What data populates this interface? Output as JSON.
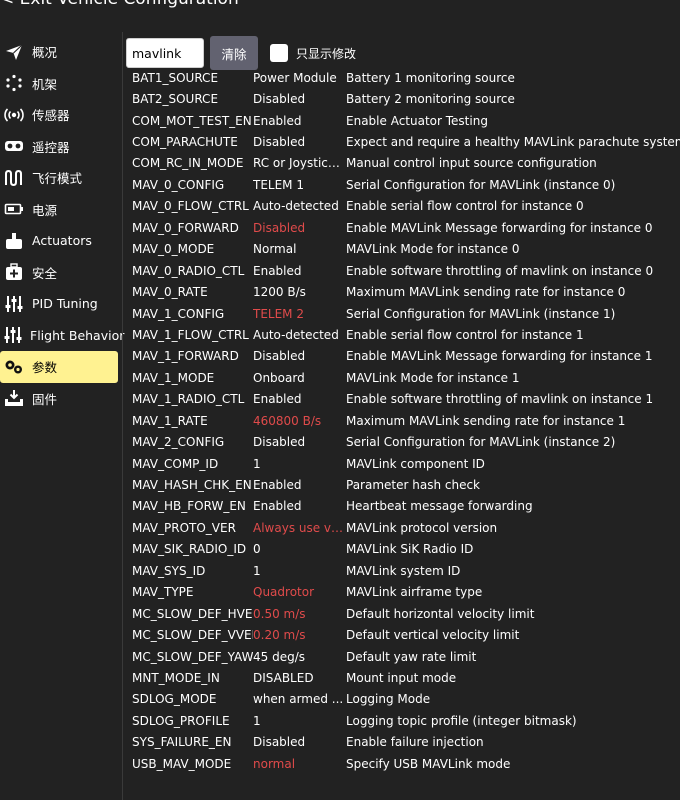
{
  "header": {
    "title": "< Exit Vehicle Configuration"
  },
  "sidebar": {
    "items": [
      {
        "label": "概况",
        "icon": "paper-plane-icon"
      },
      {
        "label": "机架",
        "icon": "airframe-dots-icon"
      },
      {
        "label": "传感器",
        "icon": "sensor-waves-icon"
      },
      {
        "label": "遥控器",
        "icon": "radio-controller-icon"
      },
      {
        "label": "飞行模式",
        "icon": "flight-modes-wave-icon"
      },
      {
        "label": "电源",
        "icon": "battery-icon"
      },
      {
        "label": "Actuators",
        "icon": "actuators-icon"
      },
      {
        "label": "安全",
        "icon": "medical-kit-icon"
      },
      {
        "label": "PID Tuning",
        "icon": "sliders-icon"
      },
      {
        "label": "Flight Behavior",
        "icon": "sliders-icon"
      },
      {
        "label": "参数",
        "icon": "gears-icon",
        "active": true
      },
      {
        "label": "固件",
        "icon": "download-tray-icon"
      }
    ]
  },
  "search": {
    "value": "mavlink",
    "clear_label": "清除",
    "show_modified_label": "只显示修改"
  },
  "colors": {
    "accent": "#fff291",
    "modified": "#e04b4b",
    "background": "#222222",
    "button": "#626270"
  },
  "params": [
    {
      "name": "BAT1_SOURCE",
      "value": "Power Module",
      "desc": "Battery 1 monitoring source",
      "modified": false
    },
    {
      "name": "BAT2_SOURCE",
      "value": "Disabled",
      "desc": "Battery 2 monitoring source",
      "modified": false
    },
    {
      "name": "COM_MOT_TEST_EN",
      "value": "Enabled",
      "desc": "Enable Actuator Testing",
      "modified": false
    },
    {
      "name": "COM_PARACHUTE",
      "value": "Disabled",
      "desc": "Expect and require a healthy MAVLink parachute system",
      "modified": false
    },
    {
      "name": "COM_RC_IN_MODE",
      "value": "RC or Joystick ...",
      "desc": "Manual control input source configuration",
      "modified": false
    },
    {
      "name": "MAV_0_CONFIG",
      "value": "TELEM 1",
      "desc": "Serial Configuration for MAVLink (instance 0)",
      "modified": false
    },
    {
      "name": "MAV_0_FLOW_CTRL",
      "value": "Auto-detected",
      "desc": "Enable serial flow control for instance 0",
      "modified": false
    },
    {
      "name": "MAV_0_FORWARD",
      "value": "Disabled",
      "desc": "Enable MAVLink Message forwarding for instance 0",
      "modified": true
    },
    {
      "name": "MAV_0_MODE",
      "value": "Normal",
      "desc": "MAVLink Mode for instance 0",
      "modified": false
    },
    {
      "name": "MAV_0_RADIO_CTL",
      "value": "Enabled",
      "desc": "Enable software throttling of mavlink on instance 0",
      "modified": false
    },
    {
      "name": "MAV_0_RATE",
      "value": "1200 B/s",
      "desc": "Maximum MAVLink sending rate for instance 0",
      "modified": false
    },
    {
      "name": "MAV_1_CONFIG",
      "value": "TELEM 2",
      "desc": "Serial Configuration for MAVLink (instance 1)",
      "modified": true
    },
    {
      "name": "MAV_1_FLOW_CTRL",
      "value": "Auto-detected",
      "desc": "Enable serial flow control for instance 1",
      "modified": false
    },
    {
      "name": "MAV_1_FORWARD",
      "value": "Disabled",
      "desc": "Enable MAVLink Message forwarding for instance 1",
      "modified": false
    },
    {
      "name": "MAV_1_MODE",
      "value": "Onboard",
      "desc": "MAVLink Mode for instance 1",
      "modified": false
    },
    {
      "name": "MAV_1_RADIO_CTL",
      "value": "Enabled",
      "desc": "Enable software throttling of mavlink on instance 1",
      "modified": false
    },
    {
      "name": "MAV_1_RATE",
      "value": "460800 B/s",
      "desc": "Maximum MAVLink sending rate for instance 1",
      "modified": true
    },
    {
      "name": "MAV_2_CONFIG",
      "value": "Disabled",
      "desc": "Serial Configuration for MAVLink (instance 2)",
      "modified": false
    },
    {
      "name": "MAV_COMP_ID",
      "value": "1",
      "desc": "MAVLink component ID",
      "modified": false
    },
    {
      "name": "MAV_HASH_CHK_EN",
      "value": "Enabled",
      "desc": "Parameter hash check",
      "modified": false
    },
    {
      "name": "MAV_HB_FORW_EN",
      "value": "Enabled",
      "desc": "Heartbeat message forwarding",
      "modified": false
    },
    {
      "name": "MAV_PROTO_VER",
      "value": "Always use ve...",
      "desc": "MAVLink protocol version",
      "modified": true
    },
    {
      "name": "MAV_SIK_RADIO_ID",
      "value": "0",
      "desc": "MAVLink SiK Radio ID",
      "modified": false
    },
    {
      "name": "MAV_SYS_ID",
      "value": "1",
      "desc": "MAVLink system ID",
      "modified": false
    },
    {
      "name": "MAV_TYPE",
      "value": "Quadrotor",
      "desc": "MAVLink airframe type",
      "modified": true
    },
    {
      "name": "MC_SLOW_DEF_HVEL",
      "value": "0.50 m/s",
      "desc": "Default horizontal velocity limit",
      "modified": true
    },
    {
      "name": "MC_SLOW_DEF_VVEL",
      "value": "0.20 m/s",
      "desc": "Default vertical velocity limit",
      "modified": true
    },
    {
      "name": "MC_SLOW_DEF_YAWR",
      "value": "45 deg/s",
      "desc": "Default yaw rate limit",
      "modified": false
    },
    {
      "name": "MNT_MODE_IN",
      "value": "DISABLED",
      "desc": "Mount input mode",
      "modified": false
    },
    {
      "name": "SDLOG_MODE",
      "value": "when armed ...",
      "desc": "Logging Mode",
      "modified": false
    },
    {
      "name": "SDLOG_PROFILE",
      "value": "1",
      "desc": "Logging topic profile (integer bitmask)",
      "modified": false
    },
    {
      "name": "SYS_FAILURE_EN",
      "value": "Disabled",
      "desc": "Enable failure injection",
      "modified": false
    },
    {
      "name": "USB_MAV_MODE",
      "value": "normal",
      "desc": "Specify USB MAVLink mode",
      "modified": true
    }
  ]
}
